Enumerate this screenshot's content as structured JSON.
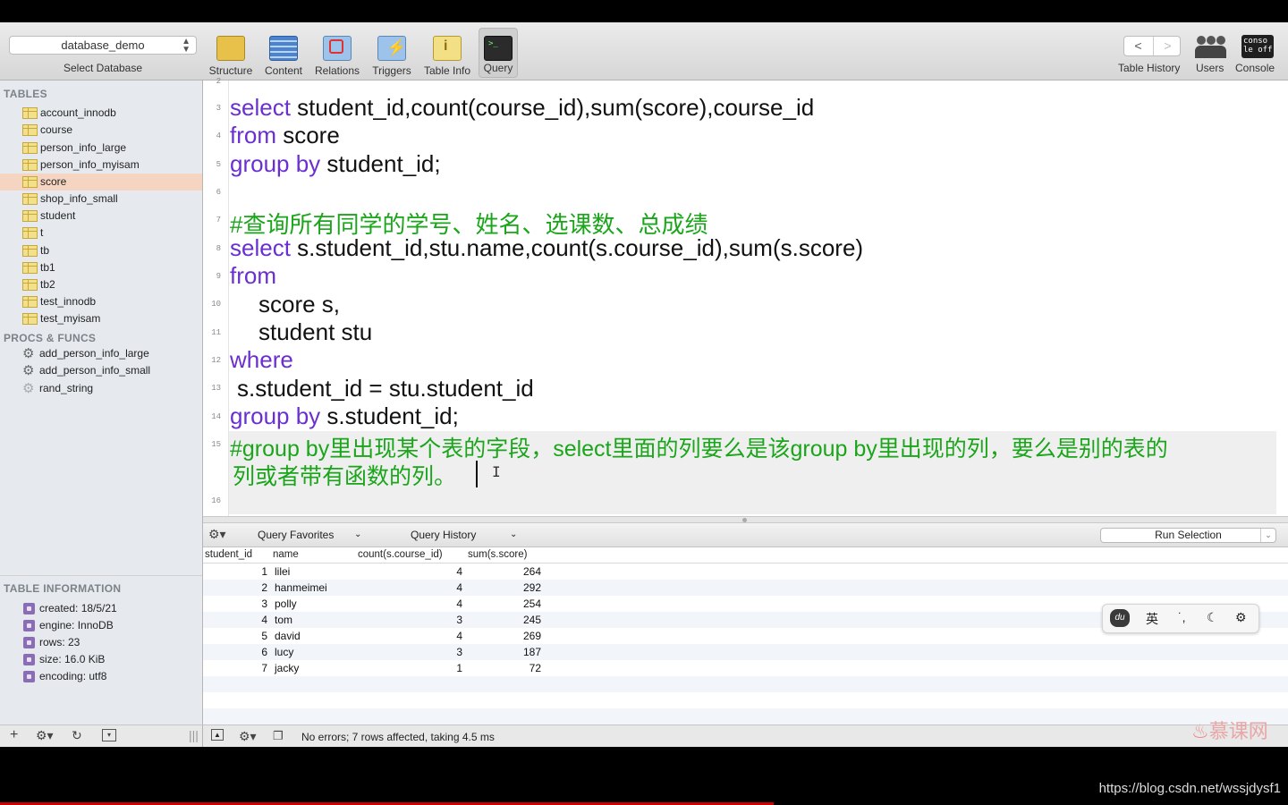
{
  "toolbar": {
    "database": "database_demo",
    "database_caption": "Select Database",
    "buttons": [
      {
        "label": "Structure",
        "icon": "structure-icon"
      },
      {
        "label": "Content",
        "icon": "content-icon"
      },
      {
        "label": "Relations",
        "icon": "relations-icon"
      },
      {
        "label": "Triggers",
        "icon": "triggers-icon"
      },
      {
        "label": "Table Info",
        "icon": "table-info-icon"
      },
      {
        "label": "Query",
        "icon": "query-icon"
      }
    ],
    "right": {
      "table_history": "Table History",
      "users": "Users",
      "console": "Console"
    }
  },
  "sidebar": {
    "tables_header": "TABLES",
    "tables": [
      "account_innodb",
      "course",
      "person_info_large",
      "person_info_myisam",
      "score",
      "shop_info_small",
      "student",
      "t",
      "tb",
      "tb1",
      "tb2",
      "test_innodb",
      "test_myisam"
    ],
    "selected_table": "score",
    "procs_header": "PROCS & FUNCS",
    "procs": [
      "add_person_info_large",
      "add_person_info_small",
      "rand_string"
    ],
    "info_header": "TABLE INFORMATION",
    "info": [
      "created: 18/5/21",
      "engine: InnoDB",
      "rows: 23",
      "size: 16.0 KiB",
      "encoding: utf8"
    ]
  },
  "editor": {
    "line_numbers": [
      "2",
      "3",
      "4",
      "5",
      "6",
      "7",
      "8",
      "9",
      "10",
      "11",
      "12",
      "13",
      "14",
      "15",
      "16"
    ],
    "lines": {
      "l3_kw": "select",
      "l3_rest": " student_id,count(course_id),sum(score),course_id",
      "l4_kw": "from",
      "l4_rest": " score",
      "l5_kw": "group by",
      "l5_rest": " student_id;",
      "l7_comment": "#查询所有同学的学号、姓名、选课数、总成绩",
      "l8_kw": "select",
      "l8_rest": " s.student_id,stu.name,count(s.course_id),sum(s.score)",
      "l9_kw": "from",
      "l10": "score s,",
      "l11": "student stu",
      "l12_kw": "where",
      "l13": "s.student_id = stu.student_id",
      "l14_kw": "group by",
      "l14_rest": " s.student_id;",
      "l15_comment_a": "#group by里出现某个表的字段，select里面的列要么是该group by里出现的列，要么是别的表的",
      "l15_comment_b": "列或者带有函数的列。"
    }
  },
  "querybar": {
    "favorites": "Query Favorites",
    "history": "Query History",
    "run": "Run Selection"
  },
  "results": {
    "columns": [
      "student_id",
      "name",
      "count(s.course_id)",
      "sum(s.score)"
    ],
    "rows": [
      [
        "1",
        "lilei",
        "4",
        "264"
      ],
      [
        "2",
        "hanmeimei",
        "4",
        "292"
      ],
      [
        "3",
        "polly",
        "4",
        "254"
      ],
      [
        "4",
        "tom",
        "3",
        "245"
      ],
      [
        "5",
        "david",
        "4",
        "269"
      ],
      [
        "6",
        "lucy",
        "3",
        "187"
      ],
      [
        "7",
        "jacky",
        "1",
        "72"
      ]
    ]
  },
  "status": {
    "message": "No errors; 7 rows affected, taking 4.5 ms"
  },
  "ime": {
    "du": "du",
    "lang": "英",
    "punct": "˙,",
    "moon": "☾",
    "gear": "⚙"
  },
  "watermark": "慕课网",
  "url": "https://blog.csdn.net/wssjdysf1",
  "colors": {
    "keyword": "#6a2fd0",
    "comment": "#1aa51a",
    "selected_row": "#f5d5c2"
  }
}
